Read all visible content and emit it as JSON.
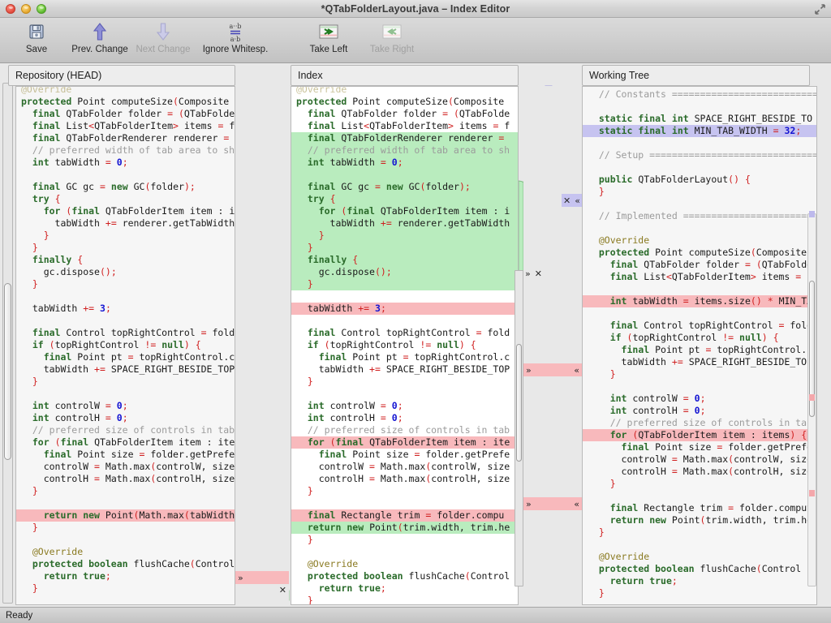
{
  "window": {
    "title": "*QTabFolderLayout.java – Index Editor",
    "traffic_lights": [
      "close",
      "minimize",
      "zoom"
    ],
    "fullscreen_icon": "fullscreen-arrows-icon"
  },
  "toolbar": {
    "items": [
      {
        "label": "Save",
        "icon": "floppy-disk-icon",
        "enabled": true
      },
      {
        "label": "Prev. Change",
        "icon": "arrow-up-icon",
        "enabled": true
      },
      {
        "label": "Next Change",
        "icon": "arrow-down-icon",
        "enabled": false
      },
      {
        "label": "Ignore Whitesp.",
        "icon": "whitespace-equals-icon",
        "enabled": true
      },
      {
        "label": "Take Left",
        "icon": "take-left-icon",
        "enabled": true
      },
      {
        "label": "Take Right",
        "icon": "take-right-icon",
        "enabled": false
      }
    ]
  },
  "panes": {
    "left": {
      "title": "Repository (HEAD)"
    },
    "middle": {
      "title": "Index"
    },
    "right": {
      "title": "Working Tree"
    }
  },
  "statusbar": {
    "text": "Ready"
  },
  "colors": {
    "added": "#b9ecbe",
    "deleted": "#f8b9bc",
    "modified": "#c6c3f0",
    "added_strong": "#9fe0a6",
    "deleted_strong": "#f6a6aa",
    "background": "#e8e8e8"
  },
  "gutter_markers": {
    "left_middle": [
      {
        "type": "deleted",
        "label_left": "»",
        "label_right": ""
      },
      {
        "type": "added",
        "label_left": "",
        "label_right": "✕"
      }
    ],
    "middle_right": [
      {
        "type": "modified",
        "label_left": "✕",
        "label_right": "≪"
      },
      {
        "type": "added",
        "label_left": "»",
        "label_right": "✕"
      },
      {
        "type": "deleted",
        "label_left": "»",
        "label_right": "≪"
      },
      {
        "type": "deleted",
        "label_left": "»",
        "label_right": "≪"
      }
    ]
  },
  "code": {
    "left": [
      {
        "state": "faded",
        "text": "@Override"
      },
      {
        "state": "normal",
        "text": "protected Point computeSize(Composite"
      },
      {
        "state": "normal",
        "text": "  final QTabFolder folder = (QTabFolde"
      },
      {
        "state": "normal",
        "text": "  final List<QTabFolderItem> items = f"
      },
      {
        "state": "normal",
        "text": "  final QTabFolderRenderer renderer ="
      },
      {
        "state": "normal",
        "text": "  // preferred width of tab area to sh"
      },
      {
        "state": "normal",
        "text": "  int tabWidth = 0;"
      },
      {
        "state": "normal",
        "text": ""
      },
      {
        "state": "normal",
        "text": "  final GC gc = new GC(folder);"
      },
      {
        "state": "normal",
        "text": "  try {"
      },
      {
        "state": "normal",
        "text": "    for (final QTabFolderItem item : i"
      },
      {
        "state": "normal",
        "text": "      tabWidth += renderer.getTabWidth"
      },
      {
        "state": "normal",
        "text": "    }"
      },
      {
        "state": "normal",
        "text": "  }"
      },
      {
        "state": "normal",
        "text": "  finally {"
      },
      {
        "state": "normal",
        "text": "    gc.dispose();"
      },
      {
        "state": "normal",
        "text": "  }"
      },
      {
        "state": "normal",
        "text": ""
      },
      {
        "state": "normal",
        "text": "  tabWidth += 3;"
      },
      {
        "state": "normal",
        "text": ""
      },
      {
        "state": "normal",
        "text": "  final Control topRightControl = fold"
      },
      {
        "state": "normal",
        "text": "  if (topRightControl != null) {"
      },
      {
        "state": "normal",
        "text": "    final Point pt = topRightControl.c"
      },
      {
        "state": "normal",
        "text": "    tabWidth += SPACE_RIGHT_BESIDE_TOP"
      },
      {
        "state": "normal",
        "text": "  }"
      },
      {
        "state": "normal",
        "text": ""
      },
      {
        "state": "normal",
        "text": "  int controlW = 0;"
      },
      {
        "state": "normal",
        "text": "  int controlH = 0;"
      },
      {
        "state": "normal",
        "text": "  // preferred size of controls in tab"
      },
      {
        "state": "normal",
        "text": "  for (final QTabFolderItem item : ite"
      },
      {
        "state": "normal",
        "text": "    final Point size = folder.getPrefe"
      },
      {
        "state": "normal",
        "text": "    controlW = Math.max(controlW, size"
      },
      {
        "state": "normal",
        "text": "    controlH = Math.max(controlH, size"
      },
      {
        "state": "normal",
        "text": "  }"
      },
      {
        "state": "normal",
        "text": ""
      },
      {
        "state": "deleted",
        "text": "    return new Point(Math.max(tabWidth,"
      },
      {
        "state": "normal",
        "text": "  }"
      },
      {
        "state": "normal",
        "text": ""
      },
      {
        "state": "normal",
        "text": "  @Override"
      },
      {
        "state": "normal",
        "text": "  protected boolean flushCache(Control c"
      },
      {
        "state": "normal",
        "text": "    return true;"
      },
      {
        "state": "normal",
        "text": "  }"
      }
    ],
    "middle": [
      {
        "state": "faded",
        "text": "@Override"
      },
      {
        "state": "normal",
        "text": "protected Point computeSize(Composite"
      },
      {
        "state": "normal",
        "text": "  final QTabFolder folder = (QTabFolde"
      },
      {
        "state": "normal",
        "text": "  final List<QTabFolderItem> items = f"
      },
      {
        "state": "added",
        "text": "  final QTabFolderRenderer renderer ="
      },
      {
        "state": "added",
        "text": "  // preferred width of tab area to sh"
      },
      {
        "state": "added",
        "text": "  int tabWidth = 0;"
      },
      {
        "state": "added",
        "text": ""
      },
      {
        "state": "added",
        "text": "  final GC gc = new GC(folder);"
      },
      {
        "state": "added",
        "text": "  try {"
      },
      {
        "state": "added",
        "text": "    for (final QTabFolderItem item : i"
      },
      {
        "state": "added",
        "text": "      tabWidth += renderer.getTabWidth"
      },
      {
        "state": "added",
        "text": "    }"
      },
      {
        "state": "added",
        "text": "  }"
      },
      {
        "state": "added",
        "text": "  finally {"
      },
      {
        "state": "added",
        "text": "    gc.dispose();"
      },
      {
        "state": "added",
        "text": "  }"
      },
      {
        "state": "normal",
        "text": ""
      },
      {
        "state": "deleted",
        "text": "  tabWidth += 3;"
      },
      {
        "state": "normal",
        "text": ""
      },
      {
        "state": "normal",
        "text": "  final Control topRightControl = fold"
      },
      {
        "state": "normal",
        "text": "  if (topRightControl != null) {"
      },
      {
        "state": "normal",
        "text": "    final Point pt = topRightControl.c"
      },
      {
        "state": "normal",
        "text": "    tabWidth += SPACE_RIGHT_BESIDE_TOP"
      },
      {
        "state": "normal",
        "text": "  }"
      },
      {
        "state": "normal",
        "text": ""
      },
      {
        "state": "normal",
        "text": "  int controlW = 0;"
      },
      {
        "state": "normal",
        "text": "  int controlH = 0;"
      },
      {
        "state": "normal",
        "text": "  // preferred size of controls in tab"
      },
      {
        "state": "deleted",
        "text": "  for (final QTabFolderItem item : ite"
      },
      {
        "state": "normal",
        "text": "    final Point size = folder.getPrefe"
      },
      {
        "state": "normal",
        "text": "    controlW = Math.max(controlW, size"
      },
      {
        "state": "normal",
        "text": "    controlH = Math.max(controlH, size"
      },
      {
        "state": "normal",
        "text": "  }"
      },
      {
        "state": "normal",
        "text": ""
      },
      {
        "state": "deleted",
        "text": "  final Rectangle trim = folder.compu"
      },
      {
        "state": "added",
        "text": "  return new Point(trim.width, trim.he"
      },
      {
        "state": "normal",
        "text": "  }"
      },
      {
        "state": "normal",
        "text": ""
      },
      {
        "state": "normal",
        "text": "  @Override"
      },
      {
        "state": "normal",
        "text": "  protected boolean flushCache(Control c"
      },
      {
        "state": "normal",
        "text": "    return true;"
      },
      {
        "state": "normal",
        "text": "  }"
      }
    ],
    "right": [
      {
        "state": "normal",
        "text": "  // Constants =========================="
      },
      {
        "state": "normal",
        "text": ""
      },
      {
        "state": "normal",
        "text": "  static final int SPACE_RIGHT_BESIDE_TO"
      },
      {
        "state": "modified",
        "text": "  static final int MIN_TAB_WIDTH = 32;"
      },
      {
        "state": "normal",
        "text": ""
      },
      {
        "state": "normal",
        "text": "  // Setup =============================="
      },
      {
        "state": "normal",
        "text": ""
      },
      {
        "state": "normal",
        "text": "  public QTabFolderLayout() {"
      },
      {
        "state": "normal",
        "text": "  }"
      },
      {
        "state": "normal",
        "text": ""
      },
      {
        "state": "normal",
        "text": "  // Implemented ========================"
      },
      {
        "state": "normal",
        "text": ""
      },
      {
        "state": "normal",
        "text": "  @Override"
      },
      {
        "state": "normal",
        "text": "  protected Point computeSize(Composite"
      },
      {
        "state": "normal",
        "text": "    final QTabFolder folder = (QTabFolde"
      },
      {
        "state": "normal",
        "text": "    final List<QTabFolderItem> items = f"
      },
      {
        "state": "normal",
        "text": ""
      },
      {
        "state": "deleted",
        "text": "    int tabWidth = items.size() * MIN_TA"
      },
      {
        "state": "normal",
        "text": ""
      },
      {
        "state": "normal",
        "text": "    final Control topRightControl = fold"
      },
      {
        "state": "normal",
        "text": "    if (topRightControl != null) {"
      },
      {
        "state": "normal",
        "text": "      final Point pt = topRightControl.c"
      },
      {
        "state": "normal",
        "text": "      tabWidth += SPACE_RIGHT_BESIDE_TOP"
      },
      {
        "state": "normal",
        "text": "    }"
      },
      {
        "state": "normal",
        "text": ""
      },
      {
        "state": "normal",
        "text": "    int controlW = 0;"
      },
      {
        "state": "normal",
        "text": "    int controlH = 0;"
      },
      {
        "state": "normal",
        "text": "    // preferred size of controls in tab"
      },
      {
        "state": "deleted",
        "text": "    for (QTabFolderItem item : items) {"
      },
      {
        "state": "normal",
        "text": "      final Point size = folder.getPrefe"
      },
      {
        "state": "normal",
        "text": "      controlW = Math.max(controlW, size"
      },
      {
        "state": "normal",
        "text": "      controlH = Math.max(controlH, size"
      },
      {
        "state": "normal",
        "text": "    }"
      },
      {
        "state": "normal",
        "text": ""
      },
      {
        "state": "normal",
        "text": "    final Rectangle trim = folder.comput"
      },
      {
        "state": "normal",
        "text": "    return new Point(trim.width, trim.he"
      },
      {
        "state": "normal",
        "text": "  }"
      },
      {
        "state": "normal",
        "text": ""
      },
      {
        "state": "normal",
        "text": "  @Override"
      },
      {
        "state": "normal",
        "text": "  protected boolean flushCache(Control c"
      },
      {
        "state": "normal",
        "text": "    return true;"
      },
      {
        "state": "normal",
        "text": "  }"
      }
    ]
  }
}
